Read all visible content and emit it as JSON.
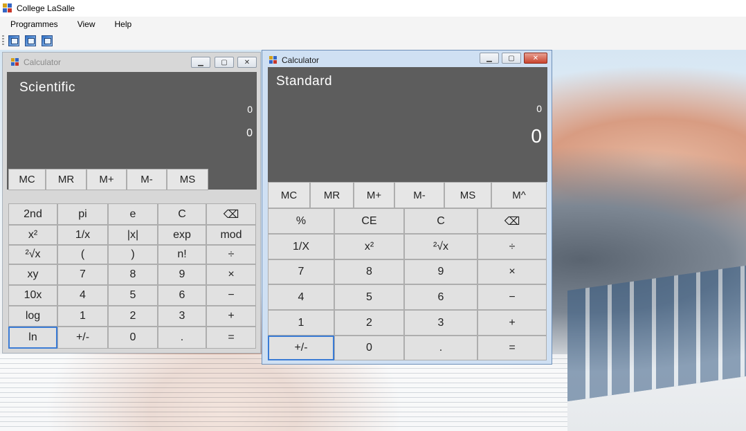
{
  "app": {
    "title": "College LaSalle",
    "menus": [
      "Programmes",
      "View",
      "Help"
    ]
  },
  "scientific": {
    "window_title": "Calculator",
    "mode": "Scientific",
    "expression": "0",
    "result": "0",
    "memory_buttons": [
      "MC",
      "MR",
      "M+",
      "M-",
      "MS"
    ],
    "keypad": [
      [
        "2nd",
        "pi",
        "e",
        "C",
        "⌫"
      ],
      [
        "x²",
        "1/x",
        "|x|",
        "exp",
        "mod"
      ],
      [
        "²√x",
        "(",
        ")",
        "n!",
        "÷"
      ],
      [
        "xy",
        "7",
        "8",
        "9",
        "×"
      ],
      [
        "10x",
        "4",
        "5",
        "6",
        "−"
      ],
      [
        "log",
        "1",
        "2",
        "3",
        "+"
      ],
      [
        "ln",
        "+/-",
        "0",
        ".",
        "="
      ]
    ]
  },
  "standard": {
    "window_title": "Calculator",
    "mode": "Standard",
    "expression": "0",
    "result": "0",
    "memory_buttons": [
      "MC",
      "MR",
      "M+",
      "M-",
      "MS",
      "M^"
    ],
    "keypad": [
      [
        "%",
        "CE",
        "C",
        "⌫"
      ],
      [
        "1/X",
        "x²",
        "²√x",
        "÷"
      ],
      [
        "7",
        "8",
        "9",
        "×"
      ],
      [
        "4",
        "5",
        "6",
        "−"
      ],
      [
        "1",
        "2",
        "3",
        "+"
      ],
      [
        "+/-",
        "0",
        ".",
        "="
      ]
    ]
  },
  "colors": {
    "display_bg": "#5d5d5d",
    "button_bg": "#e1e1e1",
    "close_red": "#c9452f",
    "focus_blue": "#3a7bd5"
  },
  "icons": {
    "window_controls": [
      "minimize-icon",
      "maximize-icon",
      "close-icon"
    ],
    "toolbar": [
      "picture-icon",
      "picture-icon",
      "picture-icon"
    ]
  }
}
